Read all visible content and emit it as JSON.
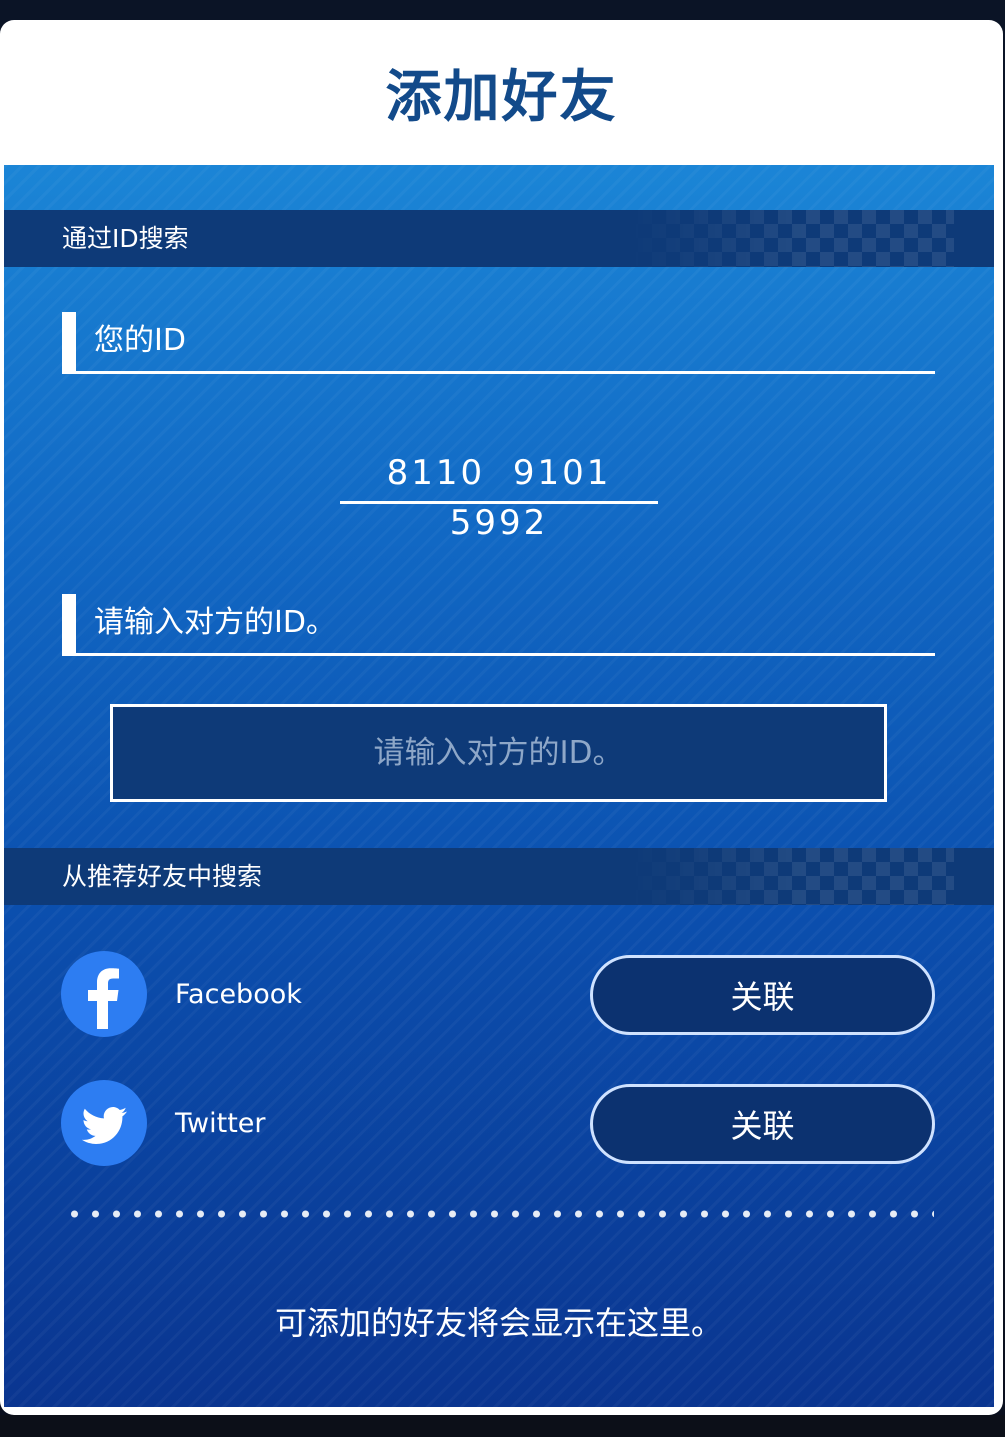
{
  "dialog": {
    "title": "添加好友"
  },
  "search_by_id": {
    "section_title": "通过ID搜索",
    "your_id_label": "您的ID",
    "your_id_value": "8110 9101 5992",
    "enter_id_label": "请输入对方的ID。",
    "input_placeholder": "请输入对方的ID。",
    "input_value": ""
  },
  "search_recommended": {
    "section_title": "从推荐好友中搜索",
    "services": [
      {
        "name": "Facebook",
        "icon": "facebook-icon",
        "button_label": "关联"
      },
      {
        "name": "Twitter",
        "icon": "twitter-icon",
        "button_label": "关联"
      }
    ],
    "empty_message": "可添加的好友将会显示在这里。"
  },
  "colors": {
    "title_blue": "#124a8a",
    "section_bar": "#0e3a78",
    "facebook_blue": "#2d7df2",
    "twitter_blue": "#2d7df2"
  }
}
